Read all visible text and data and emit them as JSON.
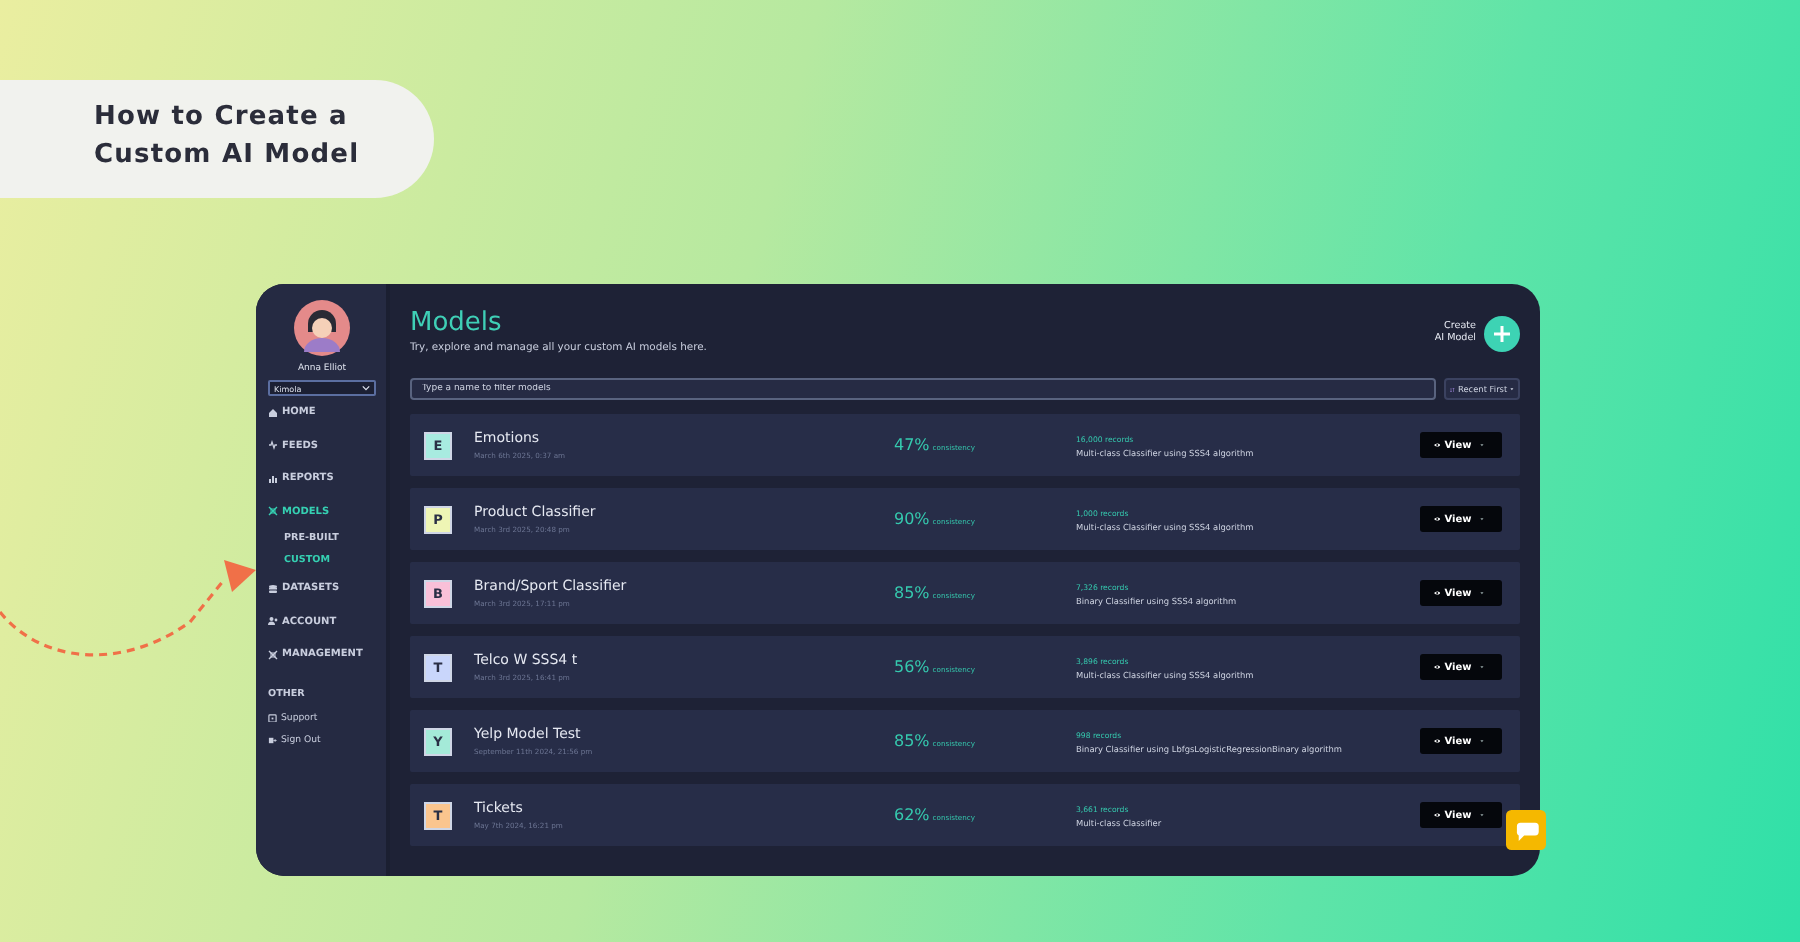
{
  "badge": {
    "title": "How to Create a Custom AI Model"
  },
  "sidebar": {
    "user_name": "Anna Elliot",
    "workspace": "Kimola",
    "items": [
      {
        "label": "HOME",
        "selected": false
      },
      {
        "label": "FEEDS",
        "selected": false
      },
      {
        "label": "REPORTS",
        "selected": false
      },
      {
        "label": "MODELS",
        "selected": true,
        "children": [
          {
            "label": "PRE-BUILT",
            "selected": false
          },
          {
            "label": "CUSTOM",
            "selected": true
          }
        ]
      },
      {
        "label": "DATASETS",
        "selected": false
      },
      {
        "label": "ACCOUNT",
        "selected": false
      },
      {
        "label": "MANAGEMENT",
        "selected": false
      }
    ],
    "other_heading": "OTHER",
    "other_items": [
      {
        "label": "Support"
      },
      {
        "label": "Sign Out"
      }
    ]
  },
  "header": {
    "title": "Models",
    "subtitle": "Try, explore and manage all your custom AI models here.",
    "create_label": "Create\nAI Model"
  },
  "filter": {
    "placeholder": "Type a name to filter models"
  },
  "sort": {
    "label": "Recent First"
  },
  "models": [
    {
      "letter": "E",
      "color": "#a8ebe0",
      "name": "Emotions",
      "date": "March 6th 2025, 0:37 am",
      "consistency": "47%",
      "consistency_label": "consistency",
      "records": "16,000 records",
      "description": "Multi-class Classifier using SSS4 algorithm",
      "action": "View"
    },
    {
      "letter": "P",
      "color": "#eef5b5",
      "name": "Product Classifier",
      "date": "March 3rd 2025, 20:48 pm",
      "consistency": "90%",
      "consistency_label": "consistency",
      "records": "1,000 records",
      "description": "Multi-class Classifier using SSS4 algorithm",
      "action": "View"
    },
    {
      "letter": "B",
      "color": "#f9c0d8",
      "name": "Brand/Sport Classifier",
      "date": "March 3rd 2025, 17:11 pm",
      "consistency": "85%",
      "consistency_label": "consistency",
      "records": "7,326 records",
      "description": "Binary Classifier using SSS4 algorithm",
      "action": "View"
    },
    {
      "letter": "T",
      "color": "#c9d6fb",
      "name": "Telco W SSS4 t",
      "date": "March 3rd 2025, 16:41 pm",
      "consistency": "56%",
      "consistency_label": "consistency",
      "records": "3,896 records",
      "description": "Multi-class Classifier using SSS4 algorithm",
      "action": "View"
    },
    {
      "letter": "Y",
      "color": "#a4ead8",
      "name": "Yelp Model Test",
      "date": "September 11th 2024, 21:56 pm",
      "consistency": "85%",
      "consistency_label": "consistency",
      "records": "998 records",
      "description": "Binary Classifier using LbfgsLogisticRegressionBinary algorithm",
      "action": "View"
    },
    {
      "letter": "T",
      "color": "#fbc58e",
      "name": "Tickets",
      "date": "May 7th 2024, 16:21 pm",
      "consistency": "62%",
      "consistency_label": "consistency",
      "records": "3,661 records",
      "description": "Multi-class Classifier",
      "action": "View"
    }
  ]
}
